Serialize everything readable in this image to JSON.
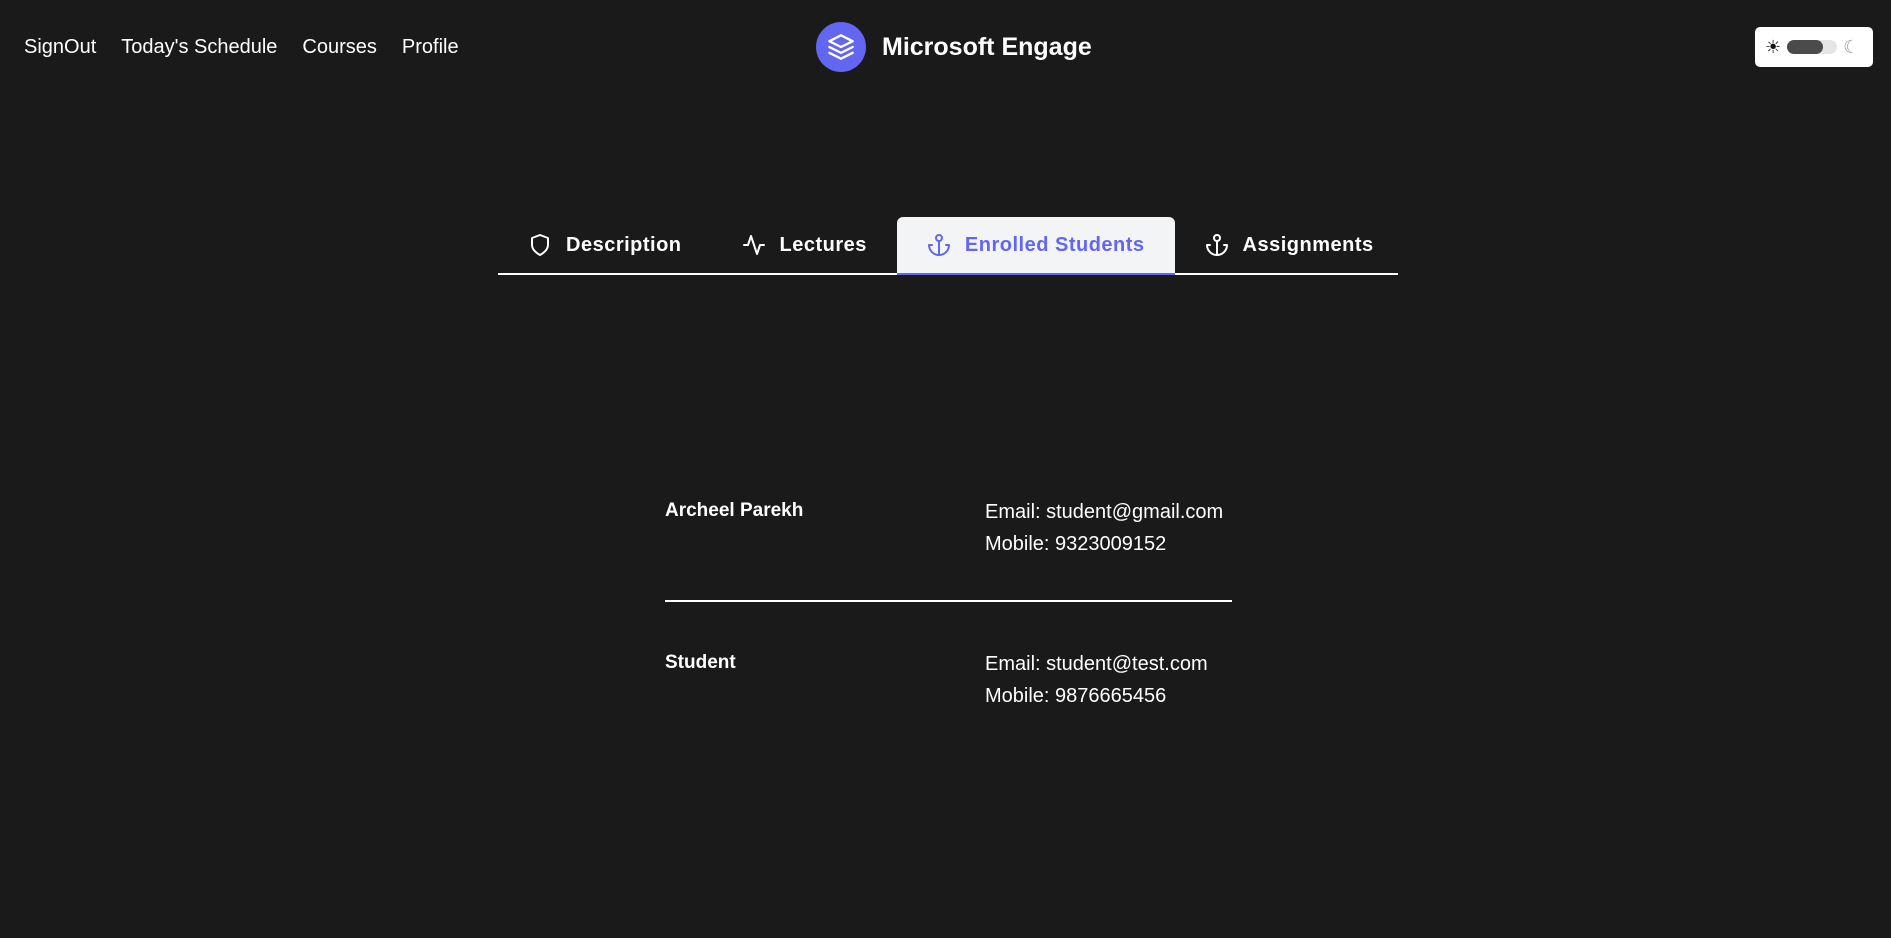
{
  "nav": {
    "signout": "SignOut",
    "schedule": "Today's Schedule",
    "courses": "Courses",
    "profile": "Profile"
  },
  "brand": {
    "title": "Microsoft Engage",
    "icon": "layers-icon",
    "color": "#6366f1"
  },
  "theme_toggle": {
    "sun_icon": "☀",
    "moon_icon": "☾"
  },
  "tabs": [
    {
      "label": "Description",
      "icon": "shield-icon",
      "active": false
    },
    {
      "label": "Lectures",
      "icon": "activity-icon",
      "active": false
    },
    {
      "label": "Enrolled Students",
      "icon": "anchor-icon",
      "active": true
    },
    {
      "label": "Assignments",
      "icon": "anchor-icon",
      "active": false
    }
  ],
  "students": [
    {
      "name": "Archeel Parekh",
      "email": "Email: student@gmail.com",
      "mobile": "Mobile: 9323009152"
    },
    {
      "name": "Student",
      "email": "Email: student@test.com",
      "mobile": "Mobile: 9876665456"
    }
  ],
  "colors": {
    "background": "#1a1a1a",
    "accent": "#6366f1",
    "active_tab_bg": "#f3f4f6"
  }
}
